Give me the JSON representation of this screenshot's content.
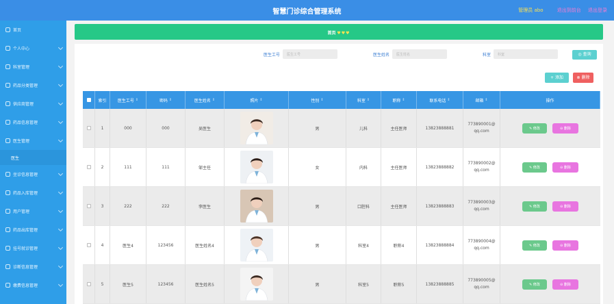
{
  "header": {
    "title": "智慧门诊综合管理系统",
    "admin": "管理员 abo",
    "links": [
      "退出到前台",
      "退出登录"
    ]
  },
  "sidebar": {
    "items": [
      {
        "label": "首页",
        "icon": "home-icon"
      },
      {
        "label": "个人中心",
        "icon": "user-icon"
      },
      {
        "label": "科室管理",
        "icon": "grid-icon"
      },
      {
        "label": "药品分类管理",
        "icon": "list-icon"
      },
      {
        "label": "供应商管理",
        "icon": "box-icon"
      },
      {
        "label": "药品信息管理",
        "icon": "pill-icon"
      },
      {
        "label": "医生管理",
        "icon": "doctor-icon"
      },
      {
        "label": "医生",
        "sub": true
      },
      {
        "label": "坐诊信息管理",
        "icon": "chart-icon"
      },
      {
        "label": "药品入库管理",
        "icon": "inbox-icon"
      },
      {
        "label": "用户管理",
        "icon": "users-icon"
      },
      {
        "label": "药品出库管理",
        "icon": "outbox-icon"
      },
      {
        "label": "挂号就诊管理",
        "icon": "ticket-icon"
      },
      {
        "label": "诊断信息管理",
        "icon": "stethoscope-icon"
      },
      {
        "label": "缴费信息管理",
        "icon": "money-icon"
      }
    ]
  },
  "breadcrumb": {
    "home": "首页",
    "dots": "♥♥♥"
  },
  "search": {
    "fields": [
      {
        "label": "医生工号",
        "placeholder": "医生工号"
      },
      {
        "label": "医生姓名",
        "placeholder": "医生姓名"
      },
      {
        "label": "科室",
        "placeholder": "科室"
      }
    ],
    "button": "◎ 查询"
  },
  "actions": {
    "add": "+ 添加",
    "delete": "⊗ 删除"
  },
  "table": {
    "columns": [
      "索引",
      "医生工号",
      "密码",
      "医生姓名",
      "照片",
      "性别",
      "科室",
      "职称",
      "联系电话",
      "邮箱",
      "操作"
    ],
    "sort_mark": "⇕",
    "rows": [
      {
        "idx": "1",
        "no": "000",
        "pwd": "000",
        "name": "吴医生",
        "gender": "男",
        "dept": "儿科",
        "title": "主任医师",
        "phone": "13823888881",
        "email": "773890001@qq.com"
      },
      {
        "idx": "2",
        "no": "111",
        "pwd": "111",
        "name": "邹主任",
        "gender": "女",
        "dept": "内科",
        "title": "主任医师",
        "phone": "13823888882",
        "email": "773890002@qq.com"
      },
      {
        "idx": "3",
        "no": "222",
        "pwd": "222",
        "name": "李医生",
        "gender": "男",
        "dept": "口腔科",
        "title": "主任医师",
        "phone": "13823888883",
        "email": "773890003@qq.com"
      },
      {
        "idx": "4",
        "no": "医生4",
        "pwd": "123456",
        "name": "医生姓名4",
        "gender": "男",
        "dept": "科室4",
        "title": "职称4",
        "phone": "13823888884",
        "email": "773890004@qq.com"
      },
      {
        "idx": "5",
        "no": "医生5",
        "pwd": "123456",
        "name": "医生姓名5",
        "gender": "男",
        "dept": "科室5",
        "title": "职称5",
        "phone": "13823888885",
        "email": "773890005@qq.com"
      }
    ],
    "edit_label": "✎ 修改",
    "delete_label": "⊖ 删除"
  },
  "colors": {
    "header": "#3a8ee6",
    "sidebar": "#2f9ee8",
    "breadcrumb": "#26c887",
    "table_head": "#3796e4",
    "edit": "#6bc98c",
    "delete": "#e875e0"
  }
}
